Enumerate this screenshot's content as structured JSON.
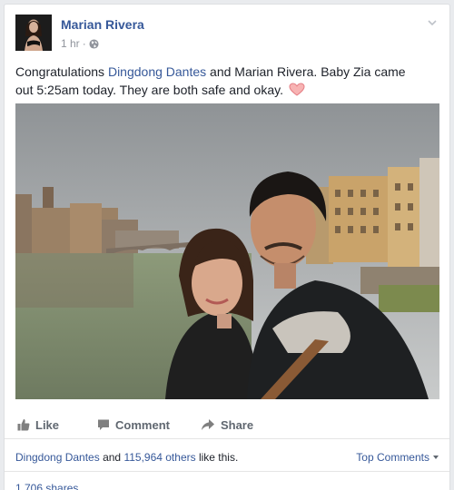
{
  "post": {
    "author": "Marian Rivera",
    "time": "1 hr",
    "dot": "·",
    "privacy_icon": "globe-icon",
    "options_icon": "chevron-down-icon",
    "text_before": "Congratulations ",
    "mention": "Dingdong Dantes",
    "text_after": " and Marian Rivera. Baby Zia came out 5:25am today. They are both safe and okay.",
    "emoji_icon": "heart-icon"
  },
  "actions": {
    "like": "Like",
    "comment": "Comment",
    "share": "Share"
  },
  "likes": {
    "name": "Dingdong Dantes",
    "and": " and ",
    "others": "115,964 others",
    "suffix": " like this.",
    "top_comments": "Top Comments"
  },
  "shares": {
    "label": "1,706 shares"
  },
  "colors": {
    "link": "#365899",
    "secondary": "#90949c",
    "action": "#606770",
    "heart": "#f4a3a3"
  }
}
